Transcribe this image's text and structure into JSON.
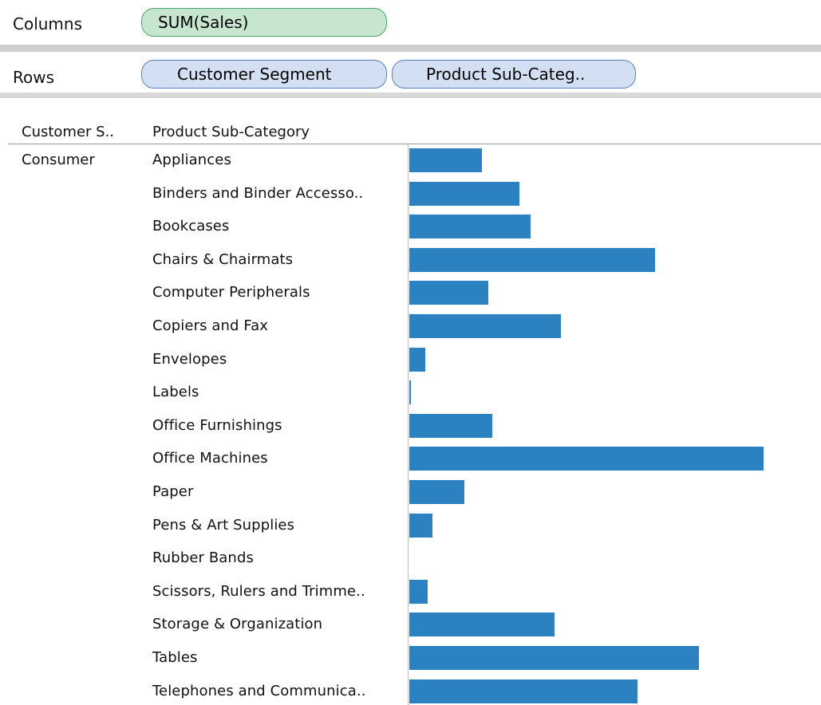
{
  "shelves": {
    "columns": {
      "label": "Columns",
      "pills": [
        "SUM(Sales)"
      ]
    },
    "rows": {
      "label": "Rows",
      "pills": [
        "Customer Segment",
        "Product Sub-Categ.."
      ]
    }
  },
  "table": {
    "headers": [
      "Customer S..",
      "Product Sub-Category"
    ],
    "segment": "Consumer",
    "categories": [
      "Appliances",
      "Binders and Binder Accesso..",
      "Bookcases",
      "Chairs & Chairmats",
      "Computer Peripherals",
      "Copiers and Fax",
      "Envelopes",
      "Labels",
      "Office Furnishings",
      "Office Machines",
      "Paper",
      "Pens & Art Supplies",
      "Rubber Bands",
      "Scissors, Rulers and Trimme..",
      "Storage & Organization",
      "Tables",
      "Telephones and Communica.."
    ]
  },
  "chart_data": {
    "type": "bar",
    "orientation": "horizontal",
    "measure": "SUM(Sales)",
    "categories": [
      "Appliances",
      "Binders and Binder Accesso..",
      "Bookcases",
      "Chairs & Chairmats",
      "Computer Peripherals",
      "Copiers and Fax",
      "Envelopes",
      "Labels",
      "Office Furnishings",
      "Office Machines",
      "Paper",
      "Pens & Art Supplies",
      "Rubber Bands",
      "Scissors, Rulers and Trimme..",
      "Storage & Organization",
      "Tables",
      "Telephones and Communica.."
    ],
    "values": [
      0.205,
      0.31,
      0.342,
      0.693,
      0.224,
      0.428,
      0.045,
      0.004,
      0.234,
      1.0,
      0.155,
      0.065,
      0.0,
      0.051,
      0.411,
      0.818,
      0.645
    ],
    "value_scale": "relative to the longest bar (no axis labels shown)",
    "bar_color": "#2c82c0",
    "grid": false,
    "legend": "none"
  },
  "colors": {
    "columns_pill": "#c6e6cf",
    "rows_pill": "#d3e0f3",
    "bar": "#2c82c0"
  }
}
